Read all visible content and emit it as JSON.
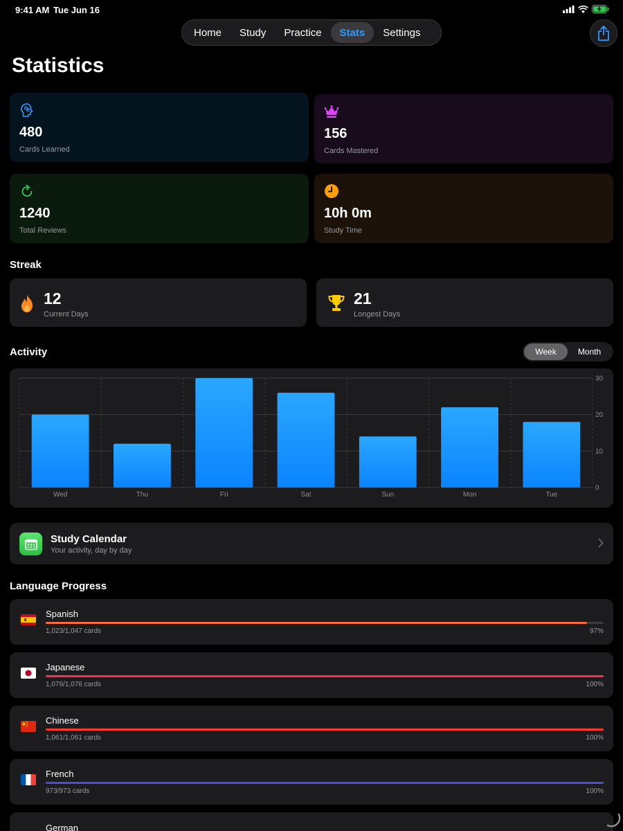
{
  "status_bar": {
    "time": "9:41 AM",
    "date": "Tue Jun 16"
  },
  "nav": {
    "tabs": [
      {
        "label": "Home"
      },
      {
        "label": "Study"
      },
      {
        "label": "Practice"
      },
      {
        "label": "Stats",
        "active": true
      },
      {
        "label": "Settings"
      }
    ]
  },
  "page_title": "Statistics",
  "stats": [
    {
      "value": "480",
      "label": "Cards Learned",
      "icon": "brain-head-icon",
      "color": "#2f9bff"
    },
    {
      "value": "156",
      "label": "Cards Mastered",
      "icon": "crown-icon",
      "color": "#e040fb"
    },
    {
      "value": "1240",
      "label": "Total Reviews",
      "icon": "refresh-icon",
      "color": "#34c759"
    },
    {
      "value": "10h 0m",
      "label": "Study Time",
      "icon": "clock-icon",
      "color": "#ff9f0a"
    }
  ],
  "streak": {
    "title": "Streak",
    "current": {
      "value": "12",
      "label": "Current Days",
      "icon": "flame-icon"
    },
    "longest": {
      "value": "21",
      "label": "Longest Days",
      "icon": "trophy-icon"
    }
  },
  "activity": {
    "title": "Activity",
    "segments": [
      {
        "label": "Week",
        "active": true
      },
      {
        "label": "Month"
      }
    ]
  },
  "chart_data": {
    "type": "bar",
    "categories": [
      "Wed",
      "Thu",
      "Fri",
      "Sat",
      "Sun",
      "Mon",
      "Tue"
    ],
    "values": [
      20,
      12,
      30,
      26,
      14,
      22,
      18
    ],
    "ylim": [
      0,
      30
    ],
    "yticks": [
      "0",
      "10",
      "20",
      "30"
    ],
    "grid": true,
    "bar_color": "#1e90ff"
  },
  "calendar": {
    "title": "Study Calendar",
    "subtitle": "Your activity, day by day"
  },
  "language_progress": {
    "title": "Language Progress",
    "languages": [
      {
        "name": "Spanish",
        "count": "1,023/1,047 cards",
        "percent": "97%",
        "fraction": 0.97,
        "color": "#ff6a3d"
      },
      {
        "name": "Japanese",
        "count": "1,076/1,076 cards",
        "percent": "100%",
        "fraction": 1.0,
        "color": "#ff2d55"
      },
      {
        "name": "Chinese",
        "count": "1,061/1,061 cards",
        "percent": "100%",
        "fraction": 1.0,
        "color": "#ff3b30"
      },
      {
        "name": "French",
        "count": "973/973 cards",
        "percent": "100%",
        "fraction": 1.0,
        "color": "#4b4fd6"
      },
      {
        "name": "German"
      }
    ]
  }
}
